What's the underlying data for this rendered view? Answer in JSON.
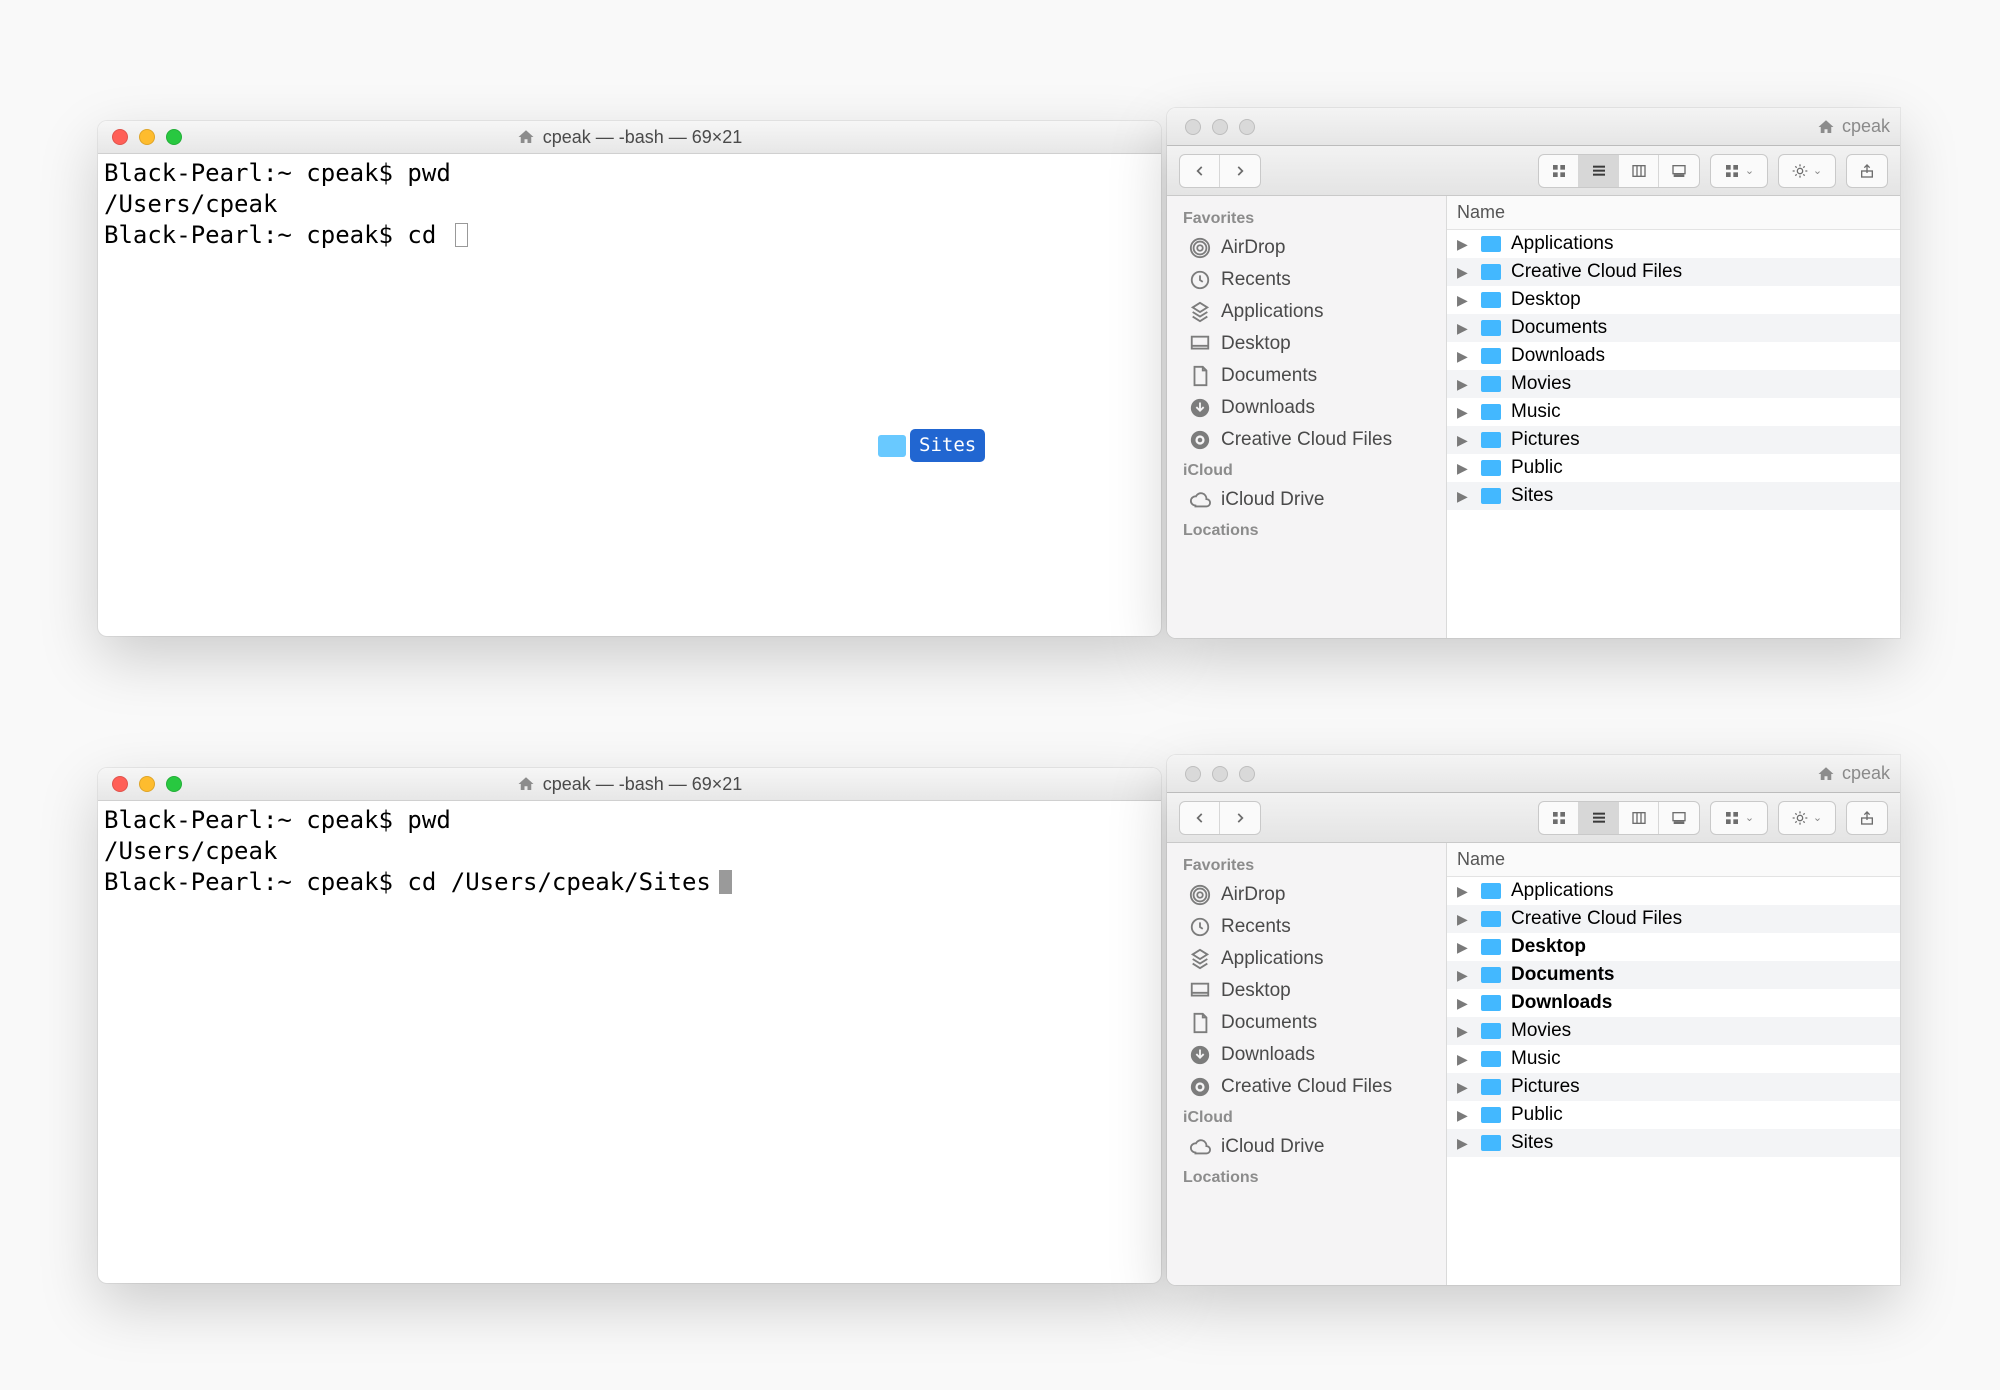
{
  "top": {
    "terminal": {
      "title": "cpeak — -bash — 69×21",
      "lines": [
        "Black-Pearl:~ cpeak$ pwd",
        "/Users/cpeak",
        "Black-Pearl:~ cpeak$ cd "
      ],
      "drag_label": "Sites"
    },
    "finder": {
      "path_label": "cpeak",
      "column_header": "Name",
      "sidebar": {
        "favorites_label": "Favorites",
        "favorites": [
          "AirDrop",
          "Recents",
          "Applications",
          "Desktop",
          "Documents",
          "Downloads",
          "Creative Cloud Files"
        ],
        "icloud_label": "iCloud",
        "icloud": [
          "iCloud Drive"
        ],
        "locations_label": "Locations"
      },
      "items": [
        "Applications",
        "Creative Cloud Files",
        "Desktop",
        "Documents",
        "Downloads",
        "Movies",
        "Music",
        "Pictures",
        "Public",
        "Sites"
      ]
    }
  },
  "bottom": {
    "terminal": {
      "title": "cpeak — -bash — 69×21",
      "lines": [
        "Black-Pearl:~ cpeak$ pwd",
        "/Users/cpeak",
        "Black-Pearl:~ cpeak$ cd /Users/cpeak/Sites"
      ]
    },
    "finder": {
      "path_label": "cpeak",
      "column_header": "Name",
      "sidebar": {
        "favorites_label": "Favorites",
        "favorites": [
          "AirDrop",
          "Recents",
          "Applications",
          "Desktop",
          "Documents",
          "Downloads",
          "Creative Cloud Files"
        ],
        "icloud_label": "iCloud",
        "icloud": [
          "iCloud Drive"
        ],
        "locations_label": "Locations"
      },
      "bold_rows": [
        "Desktop",
        "Documents",
        "Downloads"
      ],
      "items": [
        "Applications",
        "Creative Cloud Files",
        "Desktop",
        "Documents",
        "Downloads",
        "Movies",
        "Music",
        "Pictures",
        "Public",
        "Sites"
      ]
    }
  },
  "icons": {
    "favorites": [
      "airdrop",
      "clock",
      "apps",
      "desktop",
      "doc",
      "download",
      "cc"
    ],
    "icloud": [
      "cloud"
    ]
  }
}
